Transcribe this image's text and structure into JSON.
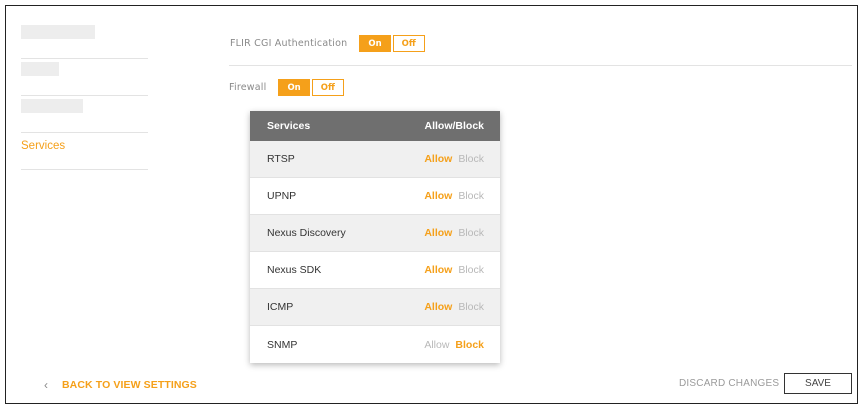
{
  "sidebar": {
    "items": [
      {
        "label": ""
      },
      {
        "label": ""
      },
      {
        "label": ""
      },
      {
        "label": "Services",
        "active": true
      }
    ]
  },
  "settings": {
    "cgi_auth": {
      "label": "FLIR CGI Authentication",
      "on_label": "On",
      "off_label": "Off",
      "selected": "On"
    },
    "firewall": {
      "label": "Firewall",
      "on_label": "On",
      "off_label": "Off",
      "selected": "On"
    }
  },
  "services_table": {
    "header": {
      "name": "Services",
      "action": "Allow/Block"
    },
    "rows": [
      {
        "name": "RTSP",
        "allow": "Allow",
        "block": "Block",
        "selected": "Allow"
      },
      {
        "name": "UPNP",
        "allow": "Allow",
        "block": "Block",
        "selected": "Allow"
      },
      {
        "name": "Nexus Discovery",
        "allow": "Allow",
        "block": "Block",
        "selected": "Allow"
      },
      {
        "name": "Nexus SDK",
        "allow": "Allow",
        "block": "Block",
        "selected": "Allow"
      },
      {
        "name": "ICMP",
        "allow": "Allow",
        "block": "Block",
        "selected": "Allow"
      },
      {
        "name": "SNMP",
        "allow": "Allow",
        "block": "Block",
        "selected": "Block"
      }
    ]
  },
  "footer": {
    "back_label": "BACK TO VIEW SETTINGS",
    "discard_label": "DISCARD CHANGES",
    "save_label": "SAVE"
  },
  "colors": {
    "accent": "#f5a01a",
    "table_header": "#6f6f6f",
    "muted_text": "#8a8a8a"
  },
  "icons": {
    "back": "chevron-left-icon"
  }
}
